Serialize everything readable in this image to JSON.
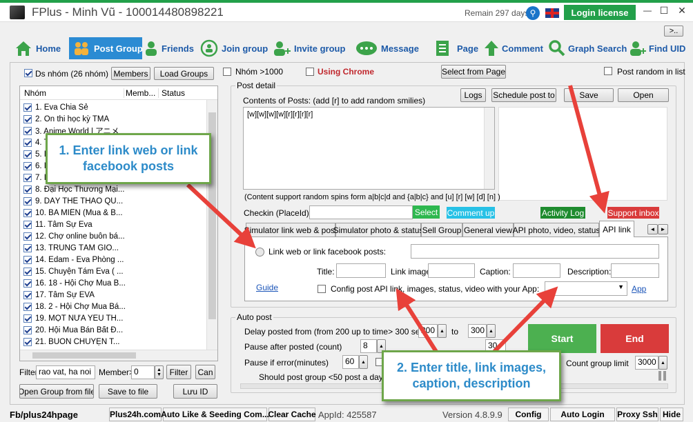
{
  "window": {
    "title": "FPlus - Minh Vũ - 100014480898221",
    "remain": "Remain 297 days",
    "login_license": "Login license",
    "more": ">..",
    "minimize": "—",
    "maximize": "☐",
    "close": "✕"
  },
  "nav": [
    {
      "label": "Home",
      "icon": "home-icon"
    },
    {
      "label": "Post Group",
      "icon": "group-post-icon"
    },
    {
      "label": "Friends",
      "icon": "friends-icon"
    },
    {
      "label": "Join group",
      "icon": "join-group-icon"
    },
    {
      "label": "Invite group",
      "icon": "invite-icon"
    },
    {
      "label": "Message",
      "icon": "message-icon"
    },
    {
      "label": "Page",
      "icon": "page-icon"
    },
    {
      "label": "Comment",
      "icon": "comment-icon"
    },
    {
      "label": "Graph Search",
      "icon": "search-icon"
    },
    {
      "label": "Find UID",
      "icon": "find-uid-icon"
    }
  ],
  "left": {
    "ds_nhom": "Ds nhóm (26 nhóm)",
    "members_btn": "Members",
    "load_groups_btn": "Load Groups",
    "columns": [
      "Nhóm",
      "Memb...",
      "Status"
    ],
    "groups": [
      "1. Eva Chia Sẻ",
      "2. Ôn thi học kỳ TMA",
      "3. Anime World | アニメ",
      "4. T",
      "5. I",
      "6. I",
      "7. I",
      "8. Đại Học Thương Mại...",
      "9. DÂY THỂ THAO QU...",
      "10. BA MIỀN (Mua & B...",
      "11. Tâm Sự Eva",
      "12. Chợ online buôn bá...",
      "13. TRUNG TÂM GIO...",
      "14. Edam - Eva Phòng ...",
      "15. Chuyện Tám Eva ( ...",
      "16. 18 - Hội Chợ Mua B...",
      "17. Tâm Sự EVA",
      "18. 2 - Hội Chợ Mua Bá...",
      "19. MỘT NỬA YÊU TH...",
      "20. Hội Mua Bán Bất Đ...",
      "21. BUÔN CHUYỆN T..."
    ],
    "filter_label": "Filter",
    "filter_value": "rao vat, ha noi",
    "member_label": "Member>",
    "member_value": "0",
    "filter_btn": "Filter",
    "can_btn": "Can",
    "open_group_btn": "Open Group from file",
    "save_file_btn": "Save to file",
    "luu_id_btn": "Lưu ID"
  },
  "top_options": {
    "nhom_1000": "Nhóm >1000",
    "using_chrome": "Using Chrome",
    "select_page": "Select from Page",
    "post_random": "Post random in list"
  },
  "post_detail": {
    "title": "Post detail",
    "contents_label": "Contents of Posts: (add [r] to add random smilies)",
    "logs_btn": "Logs",
    "schedule_btn": "Schedule post to",
    "save_btn": "Save",
    "open_btn": "Open",
    "content_value": "[w][w][w][w][r][r][r][r]",
    "spin_note": "(Content support random spins form a|b|c|d and {a|b|c} and [u] [r] [w] [d] [n] )",
    "checkin_label": "Checkin (PlaceId):",
    "select_btn": "Select",
    "comment_up_btn": "Comment up",
    "activity_log_btn": "Activity Log",
    "support_inbox_btn": "Support inbox"
  },
  "tabs": [
    "Simulator link web & post",
    "Simulator photo & status",
    "Sell Group",
    "General view",
    "API photo, video, status",
    "API link"
  ],
  "api_link": {
    "link_label": "Link web or link facebook posts:",
    "title_label": "Title:",
    "link_image_label": "Link image",
    "caption_label": "Caption:",
    "description_label": "Description:",
    "guide_link": "Guide",
    "config_label": "Config post API link, images, status, video with your App:",
    "app_link": "App"
  },
  "auto_post": {
    "title": "Auto post",
    "delay_label": "Delay posted from (from 200 up to time> 300 seconds)",
    "delay_from": "200",
    "delay_to_label": "to",
    "delay_to": "300",
    "pause_after_label": "Pause after posted (count)",
    "pause_after_value": "8",
    "pause_partial_value": "30",
    "pause_error_label": "Pause if error(minutes)",
    "pause_error_value": "60",
    "count_group_label": "Count group limit",
    "count_group_value": "3000",
    "note": "Should post group <50 post a day dela",
    "start_btn": "Start",
    "end_btn": "End"
  },
  "callouts": {
    "c1": "1. Enter link web or link facebook posts",
    "c2": "2. Enter title, link images, caption, description"
  },
  "statusbar": {
    "fb": "Fb/plus24hpage",
    "plus24h": "Plus24h.com",
    "auto_like": "Auto Like & Seeding Com...",
    "clear_cache": "Clear Cache",
    "appid": "AppId: 425587",
    "version": "Version 4.8.9.9",
    "config": "Config",
    "auto_login": "Auto Login",
    "proxy": "Proxy Ssh",
    "hide": "Hide"
  },
  "colors": {
    "accent_green": "#22a04a",
    "nav_active": "#2b8bd3",
    "start": "#4cb050",
    "end": "#d93b3b",
    "arrow": "#e8413a"
  }
}
